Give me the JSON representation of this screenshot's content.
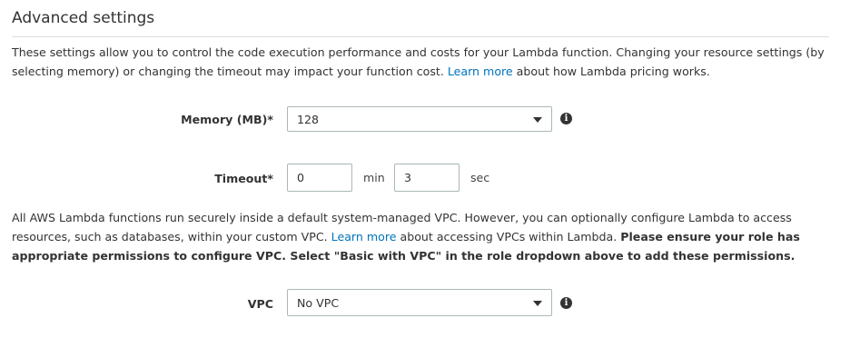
{
  "section": {
    "title": "Advanced settings"
  },
  "intro": {
    "text": "These settings allow you to control the code execution performance and costs for your Lambda function. Changing your resource settings (by selecting memory) or changing the timeout may impact your function cost. ",
    "link": "Learn more",
    "after_link": " about how Lambda pricing works."
  },
  "memory": {
    "label": "Memory (MB)*",
    "value": "128",
    "icon": "info-icon"
  },
  "timeout": {
    "label": "Timeout*",
    "min_value": "0",
    "min_unit": "min",
    "sec_value": "3",
    "sec_unit": "sec"
  },
  "vpc_note": {
    "text": "All AWS Lambda functions run securely inside a default system-managed VPC. However, you can optionally configure Lambda to access resources, such as databases, within your custom VPC. ",
    "link": "Learn more",
    "after_link": " about accessing VPCs within Lambda. ",
    "bold": "Please ensure your role has appropriate permissions to configure VPC. Select \"Basic with VPC\" in the role dropdown above to add these permissions."
  },
  "vpc": {
    "label": "VPC",
    "value": "No VPC",
    "icon": "info-icon"
  },
  "colors": {
    "link": "#0073bb",
    "border": "#aab7b8",
    "text": "#333333"
  }
}
